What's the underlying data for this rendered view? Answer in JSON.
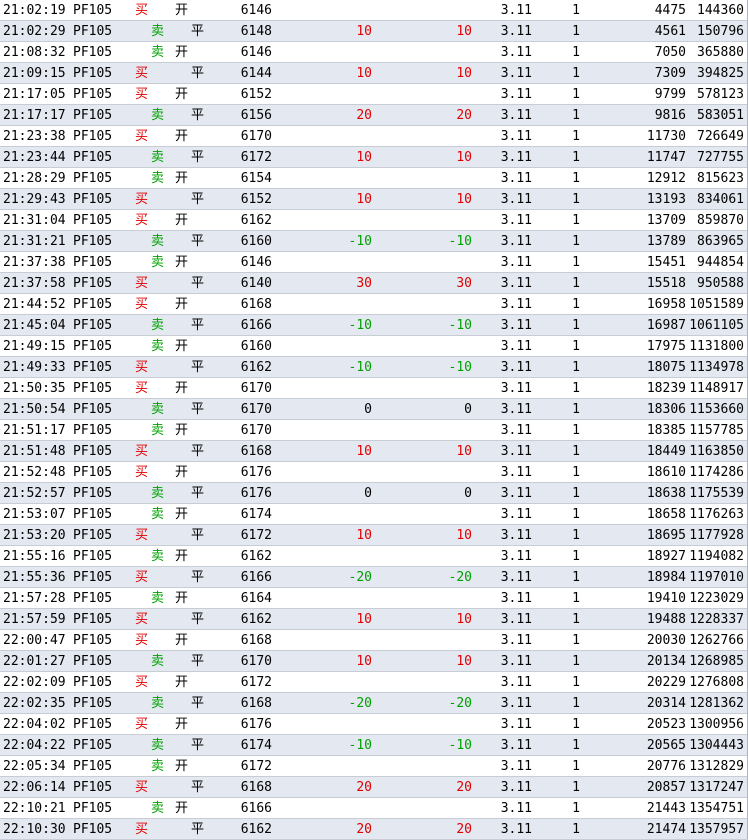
{
  "colors": {
    "buy": "#e00000",
    "sell": "#00a000",
    "alt_row": "#e4e8f0",
    "plain_row": "#ffffff"
  },
  "rows": [
    {
      "time": "21:02:19",
      "code": "PF105",
      "dir": "买",
      "offset": "开",
      "price": "6146",
      "chg1": "",
      "chg2": "",
      "ratio": "3.11",
      "vol": "1",
      "cnt": "4475",
      "total": "144360"
    },
    {
      "time": "21:02:29",
      "code": "PF105",
      "dir": "卖",
      "offset": "平",
      "price": "6148",
      "chg1": "10",
      "chg2": "10",
      "ratio": "3.11",
      "vol": "1",
      "cnt": "4561",
      "total": "150796"
    },
    {
      "time": "21:08:32",
      "code": "PF105",
      "dir": "卖",
      "offset": "开",
      "price": "6146",
      "chg1": "",
      "chg2": "",
      "ratio": "3.11",
      "vol": "1",
      "cnt": "7050",
      "total": "365880"
    },
    {
      "time": "21:09:15",
      "code": "PF105",
      "dir": "买",
      "offset": "平",
      "price": "6144",
      "chg1": "10",
      "chg2": "10",
      "ratio": "3.11",
      "vol": "1",
      "cnt": "7309",
      "total": "394825"
    },
    {
      "time": "21:17:05",
      "code": "PF105",
      "dir": "买",
      "offset": "开",
      "price": "6152",
      "chg1": "",
      "chg2": "",
      "ratio": "3.11",
      "vol": "1",
      "cnt": "9799",
      "total": "578123"
    },
    {
      "time": "21:17:17",
      "code": "PF105",
      "dir": "卖",
      "offset": "平",
      "price": "6156",
      "chg1": "20",
      "chg2": "20",
      "ratio": "3.11",
      "vol": "1",
      "cnt": "9816",
      "total": "583051"
    },
    {
      "time": "21:23:38",
      "code": "PF105",
      "dir": "买",
      "offset": "开",
      "price": "6170",
      "chg1": "",
      "chg2": "",
      "ratio": "3.11",
      "vol": "1",
      "cnt": "11730",
      "total": "726649"
    },
    {
      "time": "21:23:44",
      "code": "PF105",
      "dir": "卖",
      "offset": "平",
      "price": "6172",
      "chg1": "10",
      "chg2": "10",
      "ratio": "3.11",
      "vol": "1",
      "cnt": "11747",
      "total": "727755"
    },
    {
      "time": "21:28:29",
      "code": "PF105",
      "dir": "卖",
      "offset": "开",
      "price": "6154",
      "chg1": "",
      "chg2": "",
      "ratio": "3.11",
      "vol": "1",
      "cnt": "12912",
      "total": "815623"
    },
    {
      "time": "21:29:43",
      "code": "PF105",
      "dir": "买",
      "offset": "平",
      "price": "6152",
      "chg1": "10",
      "chg2": "10",
      "ratio": "3.11",
      "vol": "1",
      "cnt": "13193",
      "total": "834061"
    },
    {
      "time": "21:31:04",
      "code": "PF105",
      "dir": "买",
      "offset": "开",
      "price": "6162",
      "chg1": "",
      "chg2": "",
      "ratio": "3.11",
      "vol": "1",
      "cnt": "13709",
      "total": "859870"
    },
    {
      "time": "21:31:21",
      "code": "PF105",
      "dir": "卖",
      "offset": "平",
      "price": "6160",
      "chg1": "-10",
      "chg2": "-10",
      "ratio": "3.11",
      "vol": "1",
      "cnt": "13789",
      "total": "863965"
    },
    {
      "time": "21:37:38",
      "code": "PF105",
      "dir": "卖",
      "offset": "开",
      "price": "6146",
      "chg1": "",
      "chg2": "",
      "ratio": "3.11",
      "vol": "1",
      "cnt": "15451",
      "total": "944854"
    },
    {
      "time": "21:37:58",
      "code": "PF105",
      "dir": "买",
      "offset": "平",
      "price": "6140",
      "chg1": "30",
      "chg2": "30",
      "ratio": "3.11",
      "vol": "1",
      "cnt": "15518",
      "total": "950588"
    },
    {
      "time": "21:44:52",
      "code": "PF105",
      "dir": "买",
      "offset": "开",
      "price": "6168",
      "chg1": "",
      "chg2": "",
      "ratio": "3.11",
      "vol": "1",
      "cnt": "16958",
      "total": "1051589"
    },
    {
      "time": "21:45:04",
      "code": "PF105",
      "dir": "卖",
      "offset": "平",
      "price": "6166",
      "chg1": "-10",
      "chg2": "-10",
      "ratio": "3.11",
      "vol": "1",
      "cnt": "16987",
      "total": "1061105"
    },
    {
      "time": "21:49:15",
      "code": "PF105",
      "dir": "卖",
      "offset": "开",
      "price": "6160",
      "chg1": "",
      "chg2": "",
      "ratio": "3.11",
      "vol": "1",
      "cnt": "17975",
      "total": "1131800"
    },
    {
      "time": "21:49:33",
      "code": "PF105",
      "dir": "买",
      "offset": "平",
      "price": "6162",
      "chg1": "-10",
      "chg2": "-10",
      "ratio": "3.11",
      "vol": "1",
      "cnt": "18075",
      "total": "1134978"
    },
    {
      "time": "21:50:35",
      "code": "PF105",
      "dir": "买",
      "offset": "开",
      "price": "6170",
      "chg1": "",
      "chg2": "",
      "ratio": "3.11",
      "vol": "1",
      "cnt": "18239",
      "total": "1148917"
    },
    {
      "time": "21:50:54",
      "code": "PF105",
      "dir": "卖",
      "offset": "平",
      "price": "6170",
      "chg1": "0",
      "chg2": "0",
      "ratio": "3.11",
      "vol": "1",
      "cnt": "18306",
      "total": "1153660"
    },
    {
      "time": "21:51:17",
      "code": "PF105",
      "dir": "卖",
      "offset": "开",
      "price": "6170",
      "chg1": "",
      "chg2": "",
      "ratio": "3.11",
      "vol": "1",
      "cnt": "18385",
      "total": "1157785"
    },
    {
      "time": "21:51:48",
      "code": "PF105",
      "dir": "买",
      "offset": "平",
      "price": "6168",
      "chg1": "10",
      "chg2": "10",
      "ratio": "3.11",
      "vol": "1",
      "cnt": "18449",
      "total": "1163850"
    },
    {
      "time": "21:52:48",
      "code": "PF105",
      "dir": "买",
      "offset": "开",
      "price": "6176",
      "chg1": "",
      "chg2": "",
      "ratio": "3.11",
      "vol": "1",
      "cnt": "18610",
      "total": "1174286"
    },
    {
      "time": "21:52:57",
      "code": "PF105",
      "dir": "卖",
      "offset": "平",
      "price": "6176",
      "chg1": "0",
      "chg2": "0",
      "ratio": "3.11",
      "vol": "1",
      "cnt": "18638",
      "total": "1175539"
    },
    {
      "time": "21:53:07",
      "code": "PF105",
      "dir": "卖",
      "offset": "开",
      "price": "6174",
      "chg1": "",
      "chg2": "",
      "ratio": "3.11",
      "vol": "1",
      "cnt": "18658",
      "total": "1176263"
    },
    {
      "time": "21:53:20",
      "code": "PF105",
      "dir": "买",
      "offset": "平",
      "price": "6172",
      "chg1": "10",
      "chg2": "10",
      "ratio": "3.11",
      "vol": "1",
      "cnt": "18695",
      "total": "1177928"
    },
    {
      "time": "21:55:16",
      "code": "PF105",
      "dir": "卖",
      "offset": "开",
      "price": "6162",
      "chg1": "",
      "chg2": "",
      "ratio": "3.11",
      "vol": "1",
      "cnt": "18927",
      "total": "1194082"
    },
    {
      "time": "21:55:36",
      "code": "PF105",
      "dir": "买",
      "offset": "平",
      "price": "6166",
      "chg1": "-20",
      "chg2": "-20",
      "ratio": "3.11",
      "vol": "1",
      "cnt": "18984",
      "total": "1197010"
    },
    {
      "time": "21:57:28",
      "code": "PF105",
      "dir": "卖",
      "offset": "开",
      "price": "6164",
      "chg1": "",
      "chg2": "",
      "ratio": "3.11",
      "vol": "1",
      "cnt": "19410",
      "total": "1223029"
    },
    {
      "time": "21:57:59",
      "code": "PF105",
      "dir": "买",
      "offset": "平",
      "price": "6162",
      "chg1": "10",
      "chg2": "10",
      "ratio": "3.11",
      "vol": "1",
      "cnt": "19488",
      "total": "1228337"
    },
    {
      "time": "22:00:47",
      "code": "PF105",
      "dir": "买",
      "offset": "开",
      "price": "6168",
      "chg1": "",
      "chg2": "",
      "ratio": "3.11",
      "vol": "1",
      "cnt": "20030",
      "total": "1262766"
    },
    {
      "time": "22:01:27",
      "code": "PF105",
      "dir": "卖",
      "offset": "平",
      "price": "6170",
      "chg1": "10",
      "chg2": "10",
      "ratio": "3.11",
      "vol": "1",
      "cnt": "20134",
      "total": "1268985"
    },
    {
      "time": "22:02:09",
      "code": "PF105",
      "dir": "买",
      "offset": "开",
      "price": "6172",
      "chg1": "",
      "chg2": "",
      "ratio": "3.11",
      "vol": "1",
      "cnt": "20229",
      "total": "1276808"
    },
    {
      "time": "22:02:35",
      "code": "PF105",
      "dir": "卖",
      "offset": "平",
      "price": "6168",
      "chg1": "-20",
      "chg2": "-20",
      "ratio": "3.11",
      "vol": "1",
      "cnt": "20314",
      "total": "1281362"
    },
    {
      "time": "22:04:02",
      "code": "PF105",
      "dir": "买",
      "offset": "开",
      "price": "6176",
      "chg1": "",
      "chg2": "",
      "ratio": "3.11",
      "vol": "1",
      "cnt": "20523",
      "total": "1300956"
    },
    {
      "time": "22:04:22",
      "code": "PF105",
      "dir": "卖",
      "offset": "平",
      "price": "6174",
      "chg1": "-10",
      "chg2": "-10",
      "ratio": "3.11",
      "vol": "1",
      "cnt": "20565",
      "total": "1304443"
    },
    {
      "time": "22:05:34",
      "code": "PF105",
      "dir": "卖",
      "offset": "开",
      "price": "6172",
      "chg1": "",
      "chg2": "",
      "ratio": "3.11",
      "vol": "1",
      "cnt": "20776",
      "total": "1312829"
    },
    {
      "time": "22:06:14",
      "code": "PF105",
      "dir": "买",
      "offset": "平",
      "price": "6168",
      "chg1": "20",
      "chg2": "20",
      "ratio": "3.11",
      "vol": "1",
      "cnt": "20857",
      "total": "1317247"
    },
    {
      "time": "22:10:21",
      "code": "PF105",
      "dir": "卖",
      "offset": "开",
      "price": "6166",
      "chg1": "",
      "chg2": "",
      "ratio": "3.11",
      "vol": "1",
      "cnt": "21443",
      "total": "1354751"
    },
    {
      "time": "22:10:30",
      "code": "PF105",
      "dir": "买",
      "offset": "平",
      "price": "6162",
      "chg1": "20",
      "chg2": "20",
      "ratio": "3.11",
      "vol": "1",
      "cnt": "21474",
      "total": "1357957"
    }
  ]
}
